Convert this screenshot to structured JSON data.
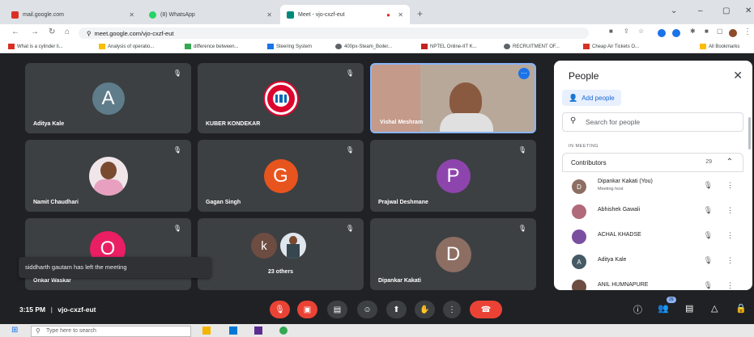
{
  "browser": {
    "tabs": [
      {
        "label": "mail.google.com",
        "fav": "#d93025"
      },
      {
        "label": "(8) WhatsApp",
        "fav": "#25d366"
      },
      {
        "label": "Meet - vjo-cxzf-eut",
        "fav": "#00897b"
      }
    ],
    "url": "meet.google.com/vjo-cxzf-eut",
    "bookmarks": [
      {
        "label": "What is a cylinder li...",
        "c": "#d93025"
      },
      {
        "label": "Analysis of operatio...",
        "c": "#fbbc04"
      },
      {
        "label": "difference between...",
        "c": "#34a853"
      },
      {
        "label": "Steering System",
        "c": "#1a73e8"
      },
      {
        "label": "400px-Steam_Boiler...",
        "c": "#5f6368"
      },
      {
        "label": "NPTEL Online-IIT K...",
        "c": "#c5221f"
      },
      {
        "label": "RECRUITMENT OF...",
        "c": "#5f6368"
      },
      {
        "label": "Cheap Air Tickets O...",
        "c": "#d93025"
      },
      {
        "label": "All Bookmarks",
        "c": "#fbbc04"
      }
    ]
  },
  "tiles": [
    {
      "name": "Aditya Kale",
      "initial": "A",
      "color": "#5f7c8a"
    },
    {
      "name": "KUBER KONDEKAR",
      "initial": "",
      "color": "#dc052d"
    },
    {
      "name": "Vishal Meshram",
      "initial": "",
      "color": "#b0b0b0"
    },
    {
      "name": "Namit Chaudhari",
      "initial": "",
      "color": "#e8a0c0"
    },
    {
      "name": "Gagan Singh",
      "initial": "G",
      "color": "#e8541e"
    },
    {
      "name": "Prajwal Deshmane",
      "initial": "P",
      "color": "#8e44ad"
    },
    {
      "name": "Onkar Waskar",
      "initial": "O",
      "color": "#e91e63"
    },
    {
      "name": "23 others",
      "initial": "k",
      "color": "#6d4c41"
    },
    {
      "name": "Dipankar Kakati",
      "initial": "D",
      "color": "#8d6e63"
    }
  ],
  "toast": "siddharth gautam has left the meeting",
  "people": {
    "title": "People",
    "add_label": "Add people",
    "search_placeholder": "Search for people",
    "in_meeting": "IN MEETING",
    "contributors_label": "Contributors",
    "contributors_count": "29",
    "list": [
      {
        "name": "Dipankar Kakati (You)",
        "sub": "Meeting host",
        "initial": "D",
        "color": "#8d6e63"
      },
      {
        "name": "Abhishek Gawali",
        "sub": "",
        "initial": "",
        "color": "#b06a7a"
      },
      {
        "name": "ACHAL KHADSE",
        "sub": "",
        "initial": "",
        "color": "#7b4fa0"
      },
      {
        "name": "Aditya Kale",
        "sub": "",
        "initial": "A",
        "color": "#455a64"
      },
      {
        "name": "ANIL HUMNAPURE",
        "sub": "",
        "initial": "",
        "color": "#6d4c41"
      }
    ]
  },
  "meeting": {
    "time": "3:15 PM",
    "separator": "|",
    "code": "vjo-cxzf-eut",
    "people_badge": "29"
  },
  "taskbar": {
    "search_placeholder": "Type here to search"
  }
}
